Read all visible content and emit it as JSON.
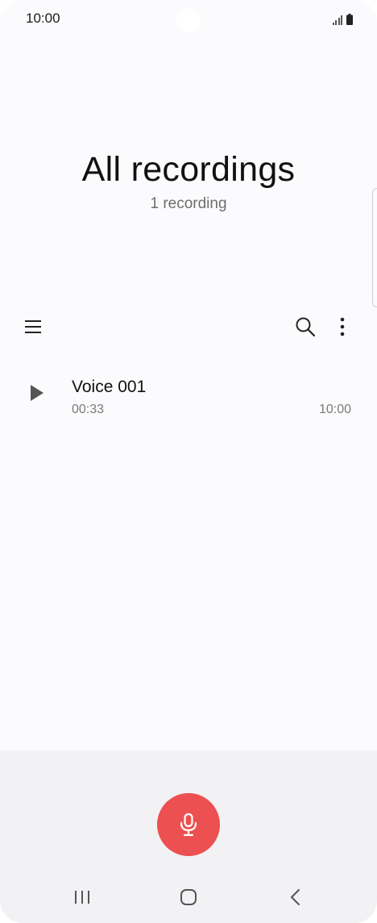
{
  "status_bar": {
    "time": "10:00"
  },
  "header": {
    "title": "All recordings",
    "subtitle": "1 recording"
  },
  "toolbar": {
    "menu_icon": "hamburger-menu-icon",
    "search_icon": "search-icon",
    "more_icon": "more-vertical-icon"
  },
  "recordings": [
    {
      "name": "Voice 001",
      "duration": "00:33",
      "time": "10:00"
    }
  ],
  "record_button": {
    "icon": "microphone-icon",
    "color": "#ec5050"
  },
  "navigation": {
    "recent_icon": "recent-apps-icon",
    "home_icon": "home-icon",
    "back_icon": "back-icon"
  }
}
